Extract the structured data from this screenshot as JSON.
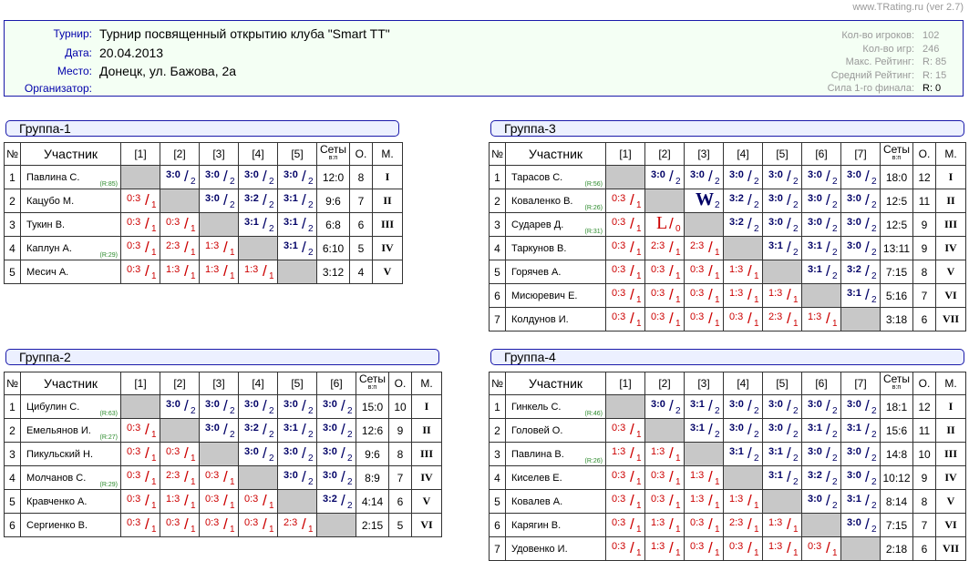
{
  "site": "www.TRating.ru (ver 2.7)",
  "tournament": {
    "labels": {
      "name": "Турнир:",
      "date": "Дата:",
      "place": "Место:",
      "org": "Организатор:"
    },
    "name": "Турнир посвященный открытию клуба \"Smart TT\"",
    "date": "20.04.2013",
    "place": "Донецк, ул. Бажова, 2а",
    "org": ""
  },
  "stats": [
    {
      "label": "Кол-во игроков:",
      "value": "102"
    },
    {
      "label": "Кол-во игр:",
      "value": "246"
    },
    {
      "label": "Макс. Рейтинг:",
      "value": "R: 85"
    },
    {
      "label": "Средний Рейтинг:",
      "value": "R: 15"
    },
    {
      "label": "Сила 1-го финала:",
      "value": "R: 0"
    }
  ],
  "col_headers": {
    "num": "№",
    "name": "Участник",
    "sets": "Сеты",
    "sets_sub": "в:п",
    "points": "О.",
    "place": "М."
  },
  "groups": [
    {
      "title": "Группа-1",
      "rounds": [
        "[1]",
        "[2]",
        "[3]",
        "[4]",
        "[5]"
      ],
      "rows": [
        {
          "n": "1",
          "name": "Павлина С.",
          "r": "(R:85)",
          "cells": [
            "",
            "3:0/2",
            "3:0/2",
            "3:0/2",
            "3:0/2"
          ],
          "sets": "12:0",
          "pts": "8",
          "pl": "I"
        },
        {
          "n": "2",
          "name": "Кацубо М.",
          "r": "",
          "cells": [
            "0:3/1",
            "",
            "3:0/2",
            "3:2/2",
            "3:1/2"
          ],
          "sets": "9:6",
          "pts": "7",
          "pl": "II"
        },
        {
          "n": "3",
          "name": "Тукин В.",
          "r": "",
          "cells": [
            "0:3/1",
            "0:3/1",
            "",
            "3:1/2",
            "3:1/2"
          ],
          "sets": "6:8",
          "pts": "6",
          "pl": "III"
        },
        {
          "n": "4",
          "name": "Каплун А.",
          "r": "(R:29)",
          "cells": [
            "0:3/1",
            "2:3/1",
            "1:3/1",
            "",
            "3:1/2"
          ],
          "sets": "6:10",
          "pts": "5",
          "pl": "IV"
        },
        {
          "n": "5",
          "name": "Месич А.",
          "r": "",
          "cells": [
            "0:3/1",
            "1:3/1",
            "1:3/1",
            "1:3/1",
            ""
          ],
          "sets": "3:12",
          "pts": "4",
          "pl": "V"
        }
      ]
    },
    {
      "title": "Группа-3",
      "rounds": [
        "[1]",
        "[2]",
        "[3]",
        "[4]",
        "[5]",
        "[6]",
        "[7]"
      ],
      "rows": [
        {
          "n": "1",
          "name": "Тарасов С.",
          "r": "(R:56)",
          "cells": [
            "",
            "3:0/2",
            "3:0/2",
            "3:0/2",
            "3:0/2",
            "3:0/2",
            "3:0/2"
          ],
          "sets": "18:0",
          "pts": "12",
          "pl": "I"
        },
        {
          "n": "2",
          "name": "Коваленко В.",
          "r": "(R:26)",
          "cells": [
            "0:3/1",
            "",
            "W/2",
            "3:2/2",
            "3:0/2",
            "3:0/2",
            "3:0/2"
          ],
          "sets": "12:5",
          "pts": "11",
          "pl": "II"
        },
        {
          "n": "3",
          "name": "Сударев Д.",
          "r": "(R:31)",
          "cells": [
            "0:3/1",
            "L/0",
            "",
            "3:2/2",
            "3:0/2",
            "3:0/2",
            "3:0/2"
          ],
          "sets": "12:5",
          "pts": "9",
          "pl": "III"
        },
        {
          "n": "4",
          "name": "Таркунов В.",
          "r": "",
          "cells": [
            "0:3/1",
            "2:3/1",
            "2:3/1",
            "",
            "3:1/2",
            "3:1/2",
            "3:0/2"
          ],
          "sets": "13:11",
          "pts": "9",
          "pl": "IV"
        },
        {
          "n": "5",
          "name": "Горячев А.",
          "r": "",
          "cells": [
            "0:3/1",
            "0:3/1",
            "0:3/1",
            "1:3/1",
            "",
            "3:1/2",
            "3:2/2"
          ],
          "sets": "7:15",
          "pts": "8",
          "pl": "V"
        },
        {
          "n": "6",
          "name": "Мисюревич Е.",
          "r": "",
          "cells": [
            "0:3/1",
            "0:3/1",
            "0:3/1",
            "1:3/1",
            "1:3/1",
            "",
            "3:1/2"
          ],
          "sets": "5:16",
          "pts": "7",
          "pl": "VI"
        },
        {
          "n": "7",
          "name": "Колдунов И.",
          "r": "",
          "cells": [
            "0:3/1",
            "0:3/1",
            "0:3/1",
            "0:3/1",
            "2:3/1",
            "1:3/1",
            ""
          ],
          "sets": "3:18",
          "pts": "6",
          "pl": "VII"
        }
      ]
    },
    {
      "title": "Группа-2",
      "rounds": [
        "[1]",
        "[2]",
        "[3]",
        "[4]",
        "[5]",
        "[6]"
      ],
      "rows": [
        {
          "n": "1",
          "name": "Цибулин С.",
          "r": "(R:63)",
          "cells": [
            "",
            "3:0/2",
            "3:0/2",
            "3:0/2",
            "3:0/2",
            "3:0/2"
          ],
          "sets": "15:0",
          "pts": "10",
          "pl": "I"
        },
        {
          "n": "2",
          "name": "Емельянов И.",
          "r": "(R:27)",
          "cells": [
            "0:3/1",
            "",
            "3:0/2",
            "3:2/2",
            "3:1/2",
            "3:0/2"
          ],
          "sets": "12:6",
          "pts": "9",
          "pl": "II"
        },
        {
          "n": "3",
          "name": "Пикульский Н.",
          "r": "",
          "cells": [
            "0:3/1",
            "0:3/1",
            "",
            "3:0/2",
            "3:0/2",
            "3:0/2"
          ],
          "sets": "9:6",
          "pts": "8",
          "pl": "III"
        },
        {
          "n": "4",
          "name": "Молчанов С.",
          "r": "(R:29)",
          "cells": [
            "0:3/1",
            "2:3/1",
            "0:3/1",
            "",
            "3:0/2",
            "3:0/2"
          ],
          "sets": "8:9",
          "pts": "7",
          "pl": "IV"
        },
        {
          "n": "5",
          "name": "Кравченко А.",
          "r": "",
          "cells": [
            "0:3/1",
            "1:3/1",
            "0:3/1",
            "0:3/1",
            "",
            "3:2/2"
          ],
          "sets": "4:14",
          "pts": "6",
          "pl": "V"
        },
        {
          "n": "6",
          "name": "Сергиенко В.",
          "r": "",
          "cells": [
            "0:3/1",
            "0:3/1",
            "0:3/1",
            "0:3/1",
            "2:3/1",
            ""
          ],
          "sets": "2:15",
          "pts": "5",
          "pl": "VI"
        }
      ]
    },
    {
      "title": "Группа-4",
      "rounds": [
        "[1]",
        "[2]",
        "[3]",
        "[4]",
        "[5]",
        "[6]",
        "[7]"
      ],
      "rows": [
        {
          "n": "1",
          "name": "Гинкель С.",
          "r": "(R:46)",
          "cells": [
            "",
            "3:0/2",
            "3:1/2",
            "3:0/2",
            "3:0/2",
            "3:0/2",
            "3:0/2"
          ],
          "sets": "18:1",
          "pts": "12",
          "pl": "I"
        },
        {
          "n": "2",
          "name": "Головей О.",
          "r": "",
          "cells": [
            "0:3/1",
            "",
            "3:1/2",
            "3:0/2",
            "3:0/2",
            "3:1/2",
            "3:1/2"
          ],
          "sets": "15:6",
          "pts": "11",
          "pl": "II"
        },
        {
          "n": "3",
          "name": "Павлина В.",
          "r": "(R:26)",
          "cells": [
            "1:3/1",
            "1:3/1",
            "",
            "3:1/2",
            "3:1/2",
            "3:0/2",
            "3:0/2"
          ],
          "sets": "14:8",
          "pts": "10",
          "pl": "III"
        },
        {
          "n": "4",
          "name": "Киселев Е.",
          "r": "",
          "cells": [
            "0:3/1",
            "0:3/1",
            "1:3/1",
            "",
            "3:1/2",
            "3:2/2",
            "3:0/2"
          ],
          "sets": "10:12",
          "pts": "9",
          "pl": "IV"
        },
        {
          "n": "5",
          "name": "Ковалев А.",
          "r": "",
          "cells": [
            "0:3/1",
            "0:3/1",
            "1:3/1",
            "1:3/1",
            "",
            "3:0/2",
            "3:1/2"
          ],
          "sets": "8:14",
          "pts": "8",
          "pl": "V"
        },
        {
          "n": "6",
          "name": "Карягин В.",
          "r": "",
          "cells": [
            "0:3/1",
            "1:3/1",
            "0:3/1",
            "2:3/1",
            "1:3/1",
            "",
            "3:0/2"
          ],
          "sets": "7:15",
          "pts": "7",
          "pl": "VI"
        },
        {
          "n": "7",
          "name": "Удовенко И.",
          "r": "",
          "cells": [
            "0:3/1",
            "1:3/1",
            "0:3/1",
            "0:3/1",
            "1:3/1",
            "0:3/1",
            ""
          ],
          "sets": "2:18",
          "pts": "6",
          "pl": "VII"
        }
      ]
    }
  ]
}
